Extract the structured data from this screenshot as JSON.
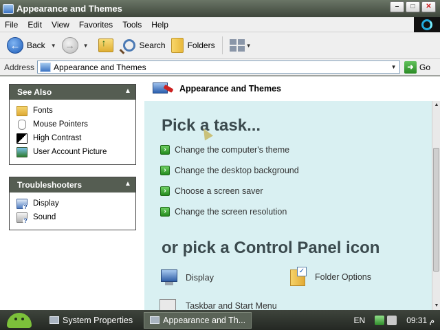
{
  "window": {
    "title": "Appearance and Themes"
  },
  "menubar": {
    "items": [
      "File",
      "Edit",
      "View",
      "Favorites",
      "Tools",
      "Help"
    ]
  },
  "toolbar": {
    "back_label": "Back",
    "search_label": "Search",
    "folders_label": "Folders"
  },
  "address": {
    "label": "Address",
    "value": "Appearance and Themes",
    "go_label": "Go"
  },
  "see_also": {
    "title": "See Also",
    "items": [
      "Fonts",
      "Mouse Pointers",
      "High Contrast",
      "User Account Picture"
    ]
  },
  "troubleshooters": {
    "title": "Troubleshooters",
    "items": [
      "Display",
      "Sound"
    ]
  },
  "main": {
    "header_title": "Appearance and Themes",
    "task_heading": "Pick a task...",
    "tasks": [
      "Change the computer's theme",
      "Change the desktop background",
      "Choose a screen saver",
      "Change the screen resolution"
    ],
    "cp_heading": "or pick a Control Panel icon",
    "cp_items": [
      "Display",
      "Folder Options"
    ],
    "cp_partial": "Taskbar and Start Menu"
  },
  "taskbar": {
    "items": [
      "System Properties",
      "Appearance and Th..."
    ],
    "lang": "EN",
    "clock": "09:31 م"
  }
}
